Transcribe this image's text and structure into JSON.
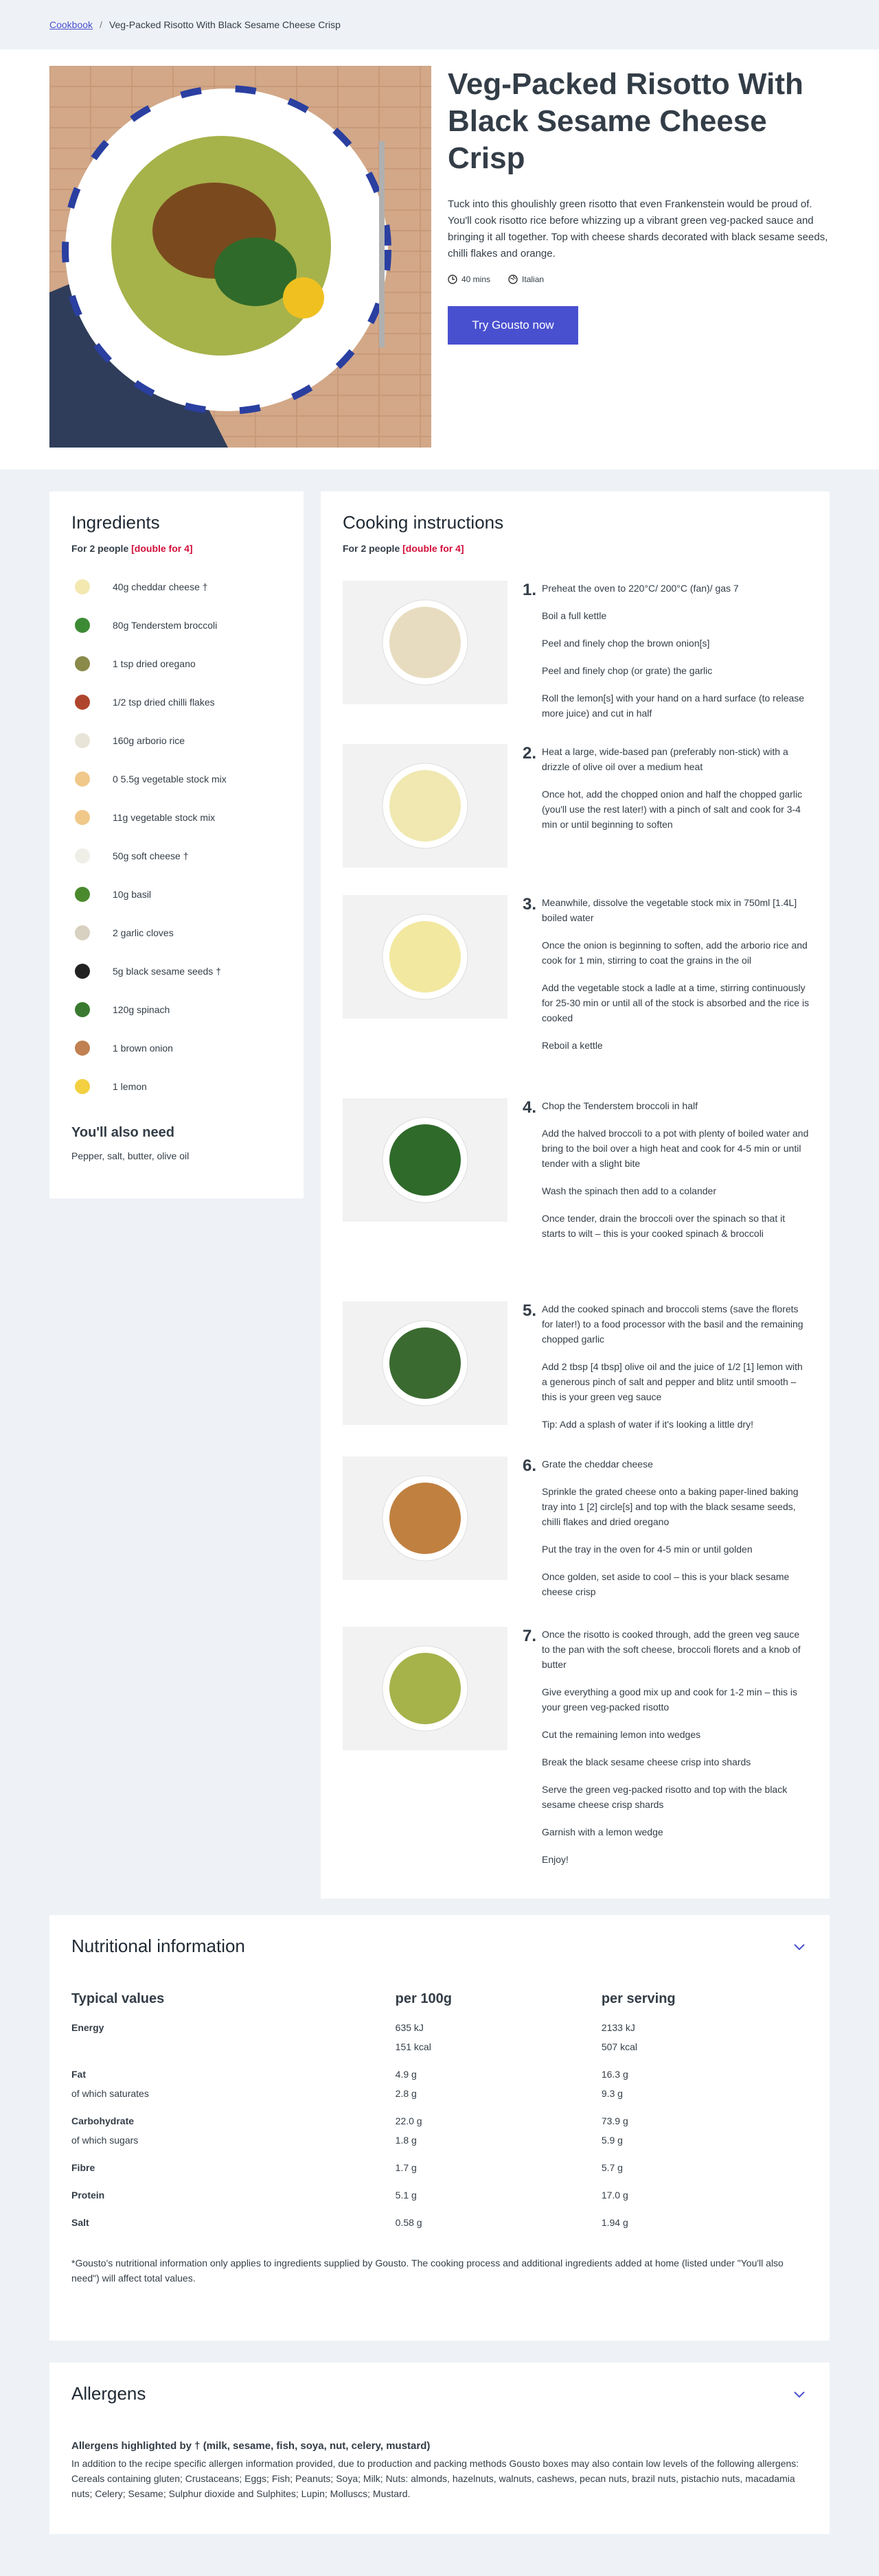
{
  "breadcrumb": {
    "root": "Cookbook",
    "current": "Veg-Packed Risotto With Black Sesame Cheese Crisp"
  },
  "recipe": {
    "title": "Veg-Packed Risotto With Black Sesame Cheese Crisp",
    "description": "Tuck into this ghoulishly green risotto that even Frankenstein would be proud of. You'll cook risotto rice before whizzing up a vibrant green veg-packed sauce and bringing it all together. Top with cheese shards decorated with black sesame seeds, chilli flakes and orange.",
    "time": "40 mins",
    "cuisine": "Italian",
    "cta": "Try Gousto now",
    "hero_icon": "risotto-plate-image"
  },
  "ingredients": {
    "title": "Ingredients",
    "servings": "For 2 people",
    "double": "[double for 4]",
    "items": [
      {
        "label": "40g cheddar cheese †",
        "color": "#f2e8b0"
      },
      {
        "label": "80g Tenderstem broccoli",
        "color": "#3d8a35"
      },
      {
        "label": "1 tsp dried oregano",
        "color": "#8a8a4a"
      },
      {
        "label": "1/2 tsp dried chilli flakes",
        "color": "#b0452d"
      },
      {
        "label": "160g arborio rice",
        "color": "#e8e4d8"
      },
      {
        "label": "0 5.5g vegetable stock mix",
        "color": "#f0c88a"
      },
      {
        "label": "11g vegetable stock mix",
        "color": "#f0c88a"
      },
      {
        "label": "50g soft cheese †",
        "color": "#efefe8"
      },
      {
        "label": "10g basil",
        "color": "#4a8a2d"
      },
      {
        "label": "2 garlic cloves",
        "color": "#d8d0c0"
      },
      {
        "label": "5g black sesame seeds †",
        "color": "#222222"
      },
      {
        "label": "120g spinach",
        "color": "#3a7a30"
      },
      {
        "label": "1 brown onion",
        "color": "#c08050"
      },
      {
        "label": "1 lemon",
        "color": "#f2d040"
      }
    ],
    "also_need_title": "You'll also need",
    "also_need": "Pepper, salt, butter, olive oil"
  },
  "cooking": {
    "title": "Cooking instructions",
    "servings": "For 2 people",
    "double": "[double for 4]",
    "steps": [
      {
        "num": "1.",
        "lines": [
          "Preheat the oven to 220°C/ 200°C (fan)/ gas 7",
          "Boil a full kettle",
          "Peel and finely chop the brown onion[s]",
          "Peel and finely chop (or grate) the garlic",
          "Roll the lemon[s] with your hand on a hard surface (to release more juice) and cut in half"
        ]
      },
      {
        "num": "2.",
        "lines": [
          "Heat a large, wide-based pan (preferably non-stick) with a drizzle of olive oil over a medium heat",
          "Once hot, add the chopped onion and half the chopped garlic (you'll use the rest later!) with a pinch of salt and cook for 3-4 min or until beginning to soften"
        ]
      },
      {
        "num": "3.",
        "lines": [
          "Meanwhile, dissolve the vegetable stock mix in 750ml [1.4L] boiled water",
          "Once the onion is beginning to soften, add the arborio rice and cook for 1 min, stirring to coat the grains in the oil",
          "Add the vegetable stock a ladle at a time, stirring continuously for 25-30 min or until all of the stock is absorbed and the rice is cooked",
          "Reboil a kettle"
        ]
      },
      {
        "num": "4.",
        "lines": [
          "Chop the Tenderstem broccoli in half",
          "Add the halved broccoli to a pot with plenty of boiled water and bring to the boil over a high heat and cook for 4-5 min or until tender with a slight bite",
          "Wash the spinach then add to a colander",
          "Once tender, drain the broccoli over the spinach so that it starts to wilt – this is your cooked spinach & broccoli"
        ]
      },
      {
        "num": "5.",
        "lines": [
          "Add the cooked spinach and broccoli stems (save the florets for later!) to a food processor with the basil and the remaining chopped garlic",
          "Add 2 tbsp [4 tbsp] olive oil and the juice of 1/2 [1] lemon with a generous pinch of salt and pepper and blitz until smooth – this is your green veg sauce",
          "Tip: Add a splash of water if it's looking a little dry!"
        ]
      },
      {
        "num": "6.",
        "lines": [
          "Grate the cheddar cheese",
          "Sprinkle the grated cheese onto a baking paper-lined baking tray into 1 [2] circle[s] and top with the black sesame seeds, chilli flakes and dried oregano",
          "Put the tray in the oven for 4-5 min or until golden",
          "Once golden, set aside to cool – this is your black sesame cheese crisp"
        ]
      },
      {
        "num": "7.",
        "lines": [
          "Once the risotto is cooked through, add the green veg sauce to the pan with the soft cheese, broccoli florets and a knob of butter",
          "Give everything a good mix up and cook for 1-2 min – this is your green veg-packed risotto",
          "Cut the remaining lemon into wedges",
          "Break the black sesame cheese crisp into shards",
          "Serve the green veg-packed risotto and top with the black sesame cheese crisp shards",
          "Garnish with a lemon wedge",
          "Enjoy!"
        ]
      }
    ]
  },
  "nutrition": {
    "title": "Nutritional information",
    "headers": [
      "Typical values",
      "per 100g",
      "per serving"
    ],
    "rows": [
      {
        "name": "Energy",
        "bold": true,
        "per100": "635 kJ",
        "serving": "2133 kJ"
      },
      {
        "name": "",
        "bold": false,
        "per100": "151 kcal",
        "serving": "507 kcal"
      },
      {
        "name": "Fat",
        "bold": true,
        "per100": "4.9 g",
        "serving": "16.3 g"
      },
      {
        "name": "of which saturates",
        "bold": false,
        "per100": "2.8 g",
        "serving": "9.3 g"
      },
      {
        "name": "Carbohydrate",
        "bold": true,
        "per100": "22.0 g",
        "serving": "73.9 g"
      },
      {
        "name": "of which sugars",
        "bold": false,
        "per100": "1.8 g",
        "serving": "5.9 g"
      },
      {
        "name": "Fibre",
        "bold": true,
        "per100": "1.7 g",
        "serving": "5.7 g"
      },
      {
        "name": "Protein",
        "bold": true,
        "per100": "5.1 g",
        "serving": "17.0 g"
      },
      {
        "name": "Salt",
        "bold": true,
        "per100": "0.58 g",
        "serving": "1.94 g"
      }
    ],
    "footnote": "*Gousto's nutritional information only applies to ingredients supplied by Gousto. The cooking process and additional ingredients added at home (listed under \"You'll also need\") will affect total values."
  },
  "allergens": {
    "title": "Allergens",
    "highlight": "Allergens highlighted by † (milk, sesame, fish, soya, nut, celery, mustard)",
    "text": "In addition to the recipe specific allergen information provided, due to production and packing methods Gousto boxes may also contain low levels of the following allergens: Cereals containing gluten; Crustaceans; Eggs; Fish; Peanuts; Soya; Milk; Nuts: almonds, hazelnuts, walnuts, cashews, pecan nuts, brazil nuts, pistachio nuts, macadamia nuts; Celery; Sesame; Sulphur dioxide and Sulphites; Lupin; Molluscs; Mustard."
  },
  "colors": {
    "accent": "#4950cf",
    "highlight": "#d30f3a"
  }
}
